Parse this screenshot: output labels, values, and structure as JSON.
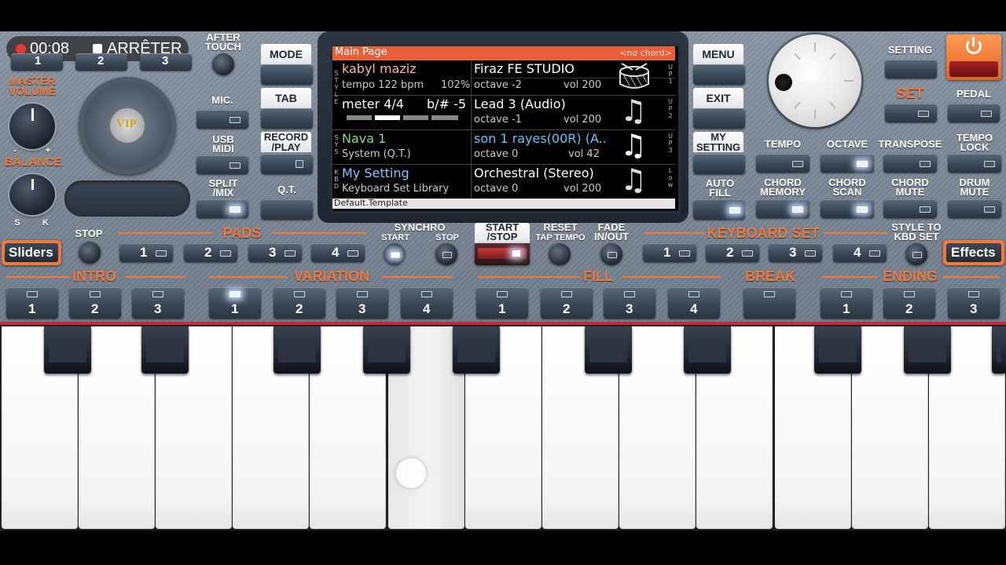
{
  "rec": {
    "timer": "00:08",
    "stop_label": "ARRÊTER"
  },
  "left": {
    "after_touch": "AFTER TOUCH",
    "master_volume": "MASTER VOLUME",
    "balance": "BALANCE",
    "balance_minus": "-",
    "balance_plus": "+",
    "s_label": "S",
    "k_label": "K",
    "top_numbers": [
      "1",
      "2",
      "3"
    ],
    "vip": "VIP",
    "mic": "MIC.",
    "usb_midi": "USB MIDI",
    "split_mix": "SPLIT /MIX"
  },
  "center_left": {
    "mode": "MODE",
    "tab": "TAB",
    "record_play": "RECORD /PLAY",
    "qt": "Q.T."
  },
  "screen": {
    "header_left": "Main Page",
    "header_right": "<no chord>",
    "style_side": [
      "S",
      "T",
      "Y",
      "L",
      "E"
    ],
    "sys_side": [
      "S",
      "Y",
      "S"
    ],
    "kbd_side": [
      "K",
      "B",
      "D"
    ],
    "up1_side": [
      "U",
      "P",
      "1"
    ],
    "up2_side": [
      "U",
      "P",
      "2"
    ],
    "up3_side": [
      "U",
      "P",
      "3"
    ],
    "low_side": [
      "L",
      "o",
      "w"
    ],
    "row1": {
      "name": "kabyl maziz",
      "tempo": "tempo 122 bpm",
      "percent": "102%",
      "right_name": "Firaz FE STUDIO",
      "octave": "octave -2",
      "vol": "vol 200"
    },
    "row2": {
      "name": "meter 4/4",
      "key": "b/# -5",
      "right_name": "Lead 3 (Audio)",
      "octave": "octave -1",
      "vol": "vol 200"
    },
    "row3": {
      "name": "Nava 1",
      "sub": "System (Q.T.)",
      "right_name": "son 1 rayes(00R) (A..",
      "octave": "octave  0",
      "vol": "vol 42"
    },
    "row4": {
      "name": "My Setting",
      "sub": "Keyboard Set Library",
      "right_name": "Orchestral (Stereo)",
      "octave": "octave  0",
      "vol": "vol 200"
    },
    "footer": "Default.Template",
    "meter_progress": 0.25
  },
  "center_right": {
    "menu": "MENU",
    "exit": "EXIT",
    "my_setting": "MY SETTING",
    "auto_fill": "AUTO FILL"
  },
  "right": {
    "setting": "SETTING",
    "set": "SET",
    "pedal": "PEDAL",
    "tempo": "TEMPO",
    "octave": "OCTAVE",
    "transpose": "TRANSPOSE",
    "tempo_lock": "TEMPO LOCK",
    "chord_memory": "CHORD MEMORY",
    "chord_scan": "CHORD SCAN",
    "chord_mute": "CHORD MUTE",
    "drum_mute": "DRUM MUTE",
    "power_icon": "power-icon"
  },
  "row_pads": {
    "sliders": "Sliders",
    "stop": "STOP",
    "pads": "PADS",
    "pad_numbers": [
      "1",
      "2",
      "3",
      "4"
    ],
    "synchro": "SYNCHRO",
    "synchro_start": "START",
    "synchro_stop": "STOP",
    "start_stop": "START /STOP",
    "reset": "RESET",
    "tap_tempo": "TAP TEMPO",
    "fade": "FADE IN/OUT",
    "keyboard_set": "KEYBOARD SET",
    "kbd_numbers": [
      "1",
      "2",
      "3",
      "4"
    ],
    "style_to_kbd": "STYLE TO KBD SET",
    "effects": "Effects"
  },
  "row_sections": {
    "intro": "INTRO",
    "variation": "VARIATION",
    "fill": "FILL",
    "break": "BREAK",
    "ending": "ENDING",
    "intro_nums": [
      "1",
      "2",
      "3"
    ],
    "variation_nums": [
      "1",
      "2",
      "3",
      "4"
    ],
    "fill_nums": [
      "1",
      "2",
      "3",
      "4"
    ],
    "ending_nums": [
      "1",
      "2",
      "3"
    ]
  },
  "colors": {
    "accent": "#f07a3c",
    "screen_header": "#e8603a",
    "highlight": "#5cc8ff",
    "green": "#7de07d"
  }
}
